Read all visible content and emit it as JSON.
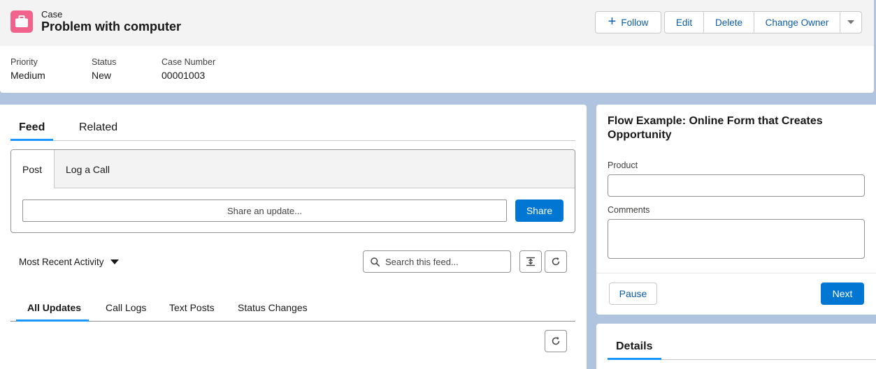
{
  "record": {
    "type_label": "Case",
    "title": "Problem with computer"
  },
  "actions": {
    "follow": "Follow",
    "edit": "Edit",
    "delete": "Delete",
    "change_owner": "Change Owner"
  },
  "highlights": [
    {
      "label": "Priority",
      "value": "Medium"
    },
    {
      "label": "Status",
      "value": "New"
    },
    {
      "label": "Case Number",
      "value": "00001003"
    }
  ],
  "feed": {
    "tabs": [
      "Feed",
      "Related"
    ],
    "active_tab": "Feed",
    "publisher": {
      "tabs": [
        "Post",
        "Log a Call"
      ],
      "active_tab": "Post",
      "placeholder": "Share an update...",
      "share_label": "Share"
    },
    "sort_label": "Most Recent Activity",
    "search_placeholder": "Search this feed...",
    "filters": [
      "All Updates",
      "Call Logs",
      "Text Posts",
      "Status Changes"
    ],
    "active_filter": "All Updates"
  },
  "flow": {
    "title": "Flow Example: Online Form that Creates Opportunity",
    "product_label": "Product",
    "product_value": "",
    "comments_label": "Comments",
    "comments_value": "",
    "pause_label": "Pause",
    "next_label": "Next"
  },
  "details": {
    "tab": "Details"
  },
  "colors": {
    "brand_blue": "#0176d3",
    "link_blue": "#0b5cab",
    "tab_indicator": "#1b96ff",
    "case_icon": "#f2638c",
    "background": "#b0c4df"
  }
}
